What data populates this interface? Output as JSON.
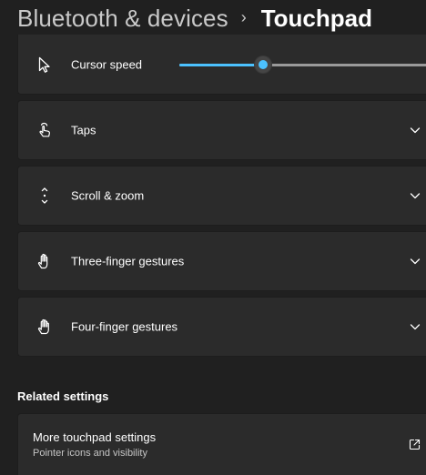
{
  "breadcrumb": {
    "parent": "Bluetooth & devices",
    "separator": "›",
    "current": "Touchpad"
  },
  "settings": {
    "cursor_speed": {
      "label": "Cursor speed",
      "icon": "cursor-arrow-icon",
      "slider_value_percent": 34
    },
    "items": [
      {
        "label": "Taps",
        "icon": "tap-hand-icon"
      },
      {
        "label": "Scroll & zoom",
        "icon": "scroll-arrows-icon"
      },
      {
        "label": "Three-finger gestures",
        "icon": "three-finger-hand-icon"
      },
      {
        "label": "Four-finger gestures",
        "icon": "four-finger-hand-icon"
      }
    ]
  },
  "related": {
    "heading": "Related settings",
    "link": {
      "title": "More touchpad settings",
      "subtitle": "Pointer icons and visibility",
      "icon": "open-external-icon"
    }
  },
  "colors": {
    "background": "#202020",
    "card": "#2b2b2b",
    "accent": "#4cc2ff"
  }
}
